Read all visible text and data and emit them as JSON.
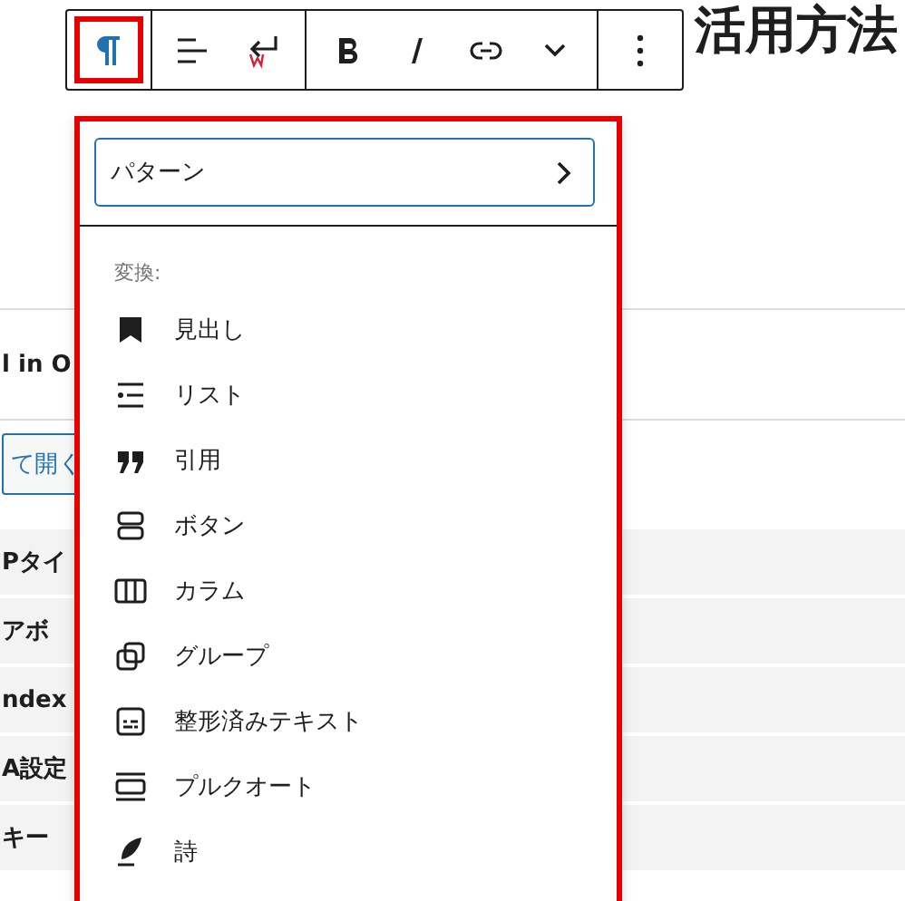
{
  "heading": {
    "text": "活用方法"
  },
  "background_rows": [
    {
      "text": "l in O",
      "kind": "plain"
    },
    {
      "text": "て開く",
      "kind": "button"
    },
    {
      "text": "Pタイ",
      "kind": "shaded"
    },
    {
      "text": "アボ",
      "kind": "shaded"
    },
    {
      "text": "ndex",
      "kind": "shaded"
    },
    {
      "text": "A設定",
      "kind": "shaded"
    },
    {
      "text": "キー",
      "kind": "shaded"
    }
  ],
  "toolbar": {
    "groups": [
      [
        {
          "kind": "paragraph",
          "highlighted": true
        }
      ],
      [
        {
          "kind": "align",
          "highlighted": false
        },
        {
          "kind": "enter",
          "highlighted": false
        }
      ],
      [
        {
          "kind": "bold",
          "highlighted": false
        },
        {
          "kind": "italic",
          "highlighted": false
        },
        {
          "kind": "link",
          "highlighted": false
        },
        {
          "kind": "more",
          "highlighted": false
        }
      ],
      [
        {
          "kind": "options",
          "highlighted": false
        }
      ]
    ]
  },
  "transform_menu": {
    "highlighted": true,
    "patterns_button": "パターン",
    "section_label": "変換:",
    "items": [
      {
        "kind": "heading",
        "label": "見出し"
      },
      {
        "kind": "list",
        "label": "リスト"
      },
      {
        "kind": "quote",
        "label": "引用"
      },
      {
        "kind": "buttons",
        "label": "ボタン"
      },
      {
        "kind": "columns",
        "label": "カラム"
      },
      {
        "kind": "group",
        "label": "グループ"
      },
      {
        "kind": "preformatted",
        "label": "整形済みテキスト"
      },
      {
        "kind": "pullquote",
        "label": "プルクオート"
      },
      {
        "kind": "verse",
        "label": "詩"
      }
    ]
  }
}
